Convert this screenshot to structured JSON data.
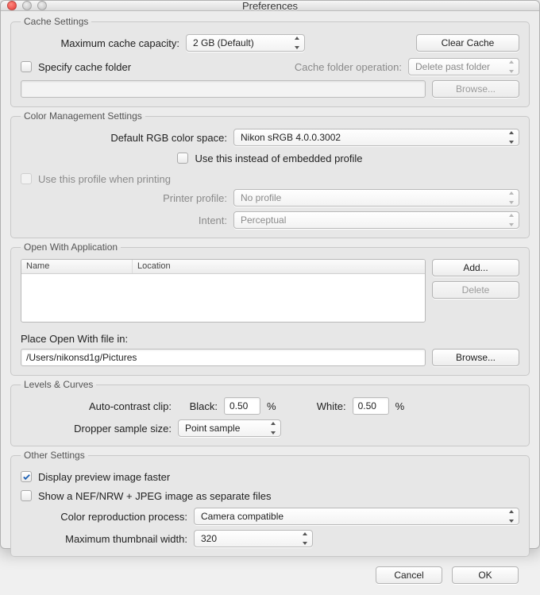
{
  "window": {
    "title": "Preferences"
  },
  "cache": {
    "legend": "Cache Settings",
    "max_label": "Maximum cache capacity:",
    "max_value": "2 GB (Default)",
    "clear_btn": "Clear Cache",
    "specify_label": "Specify cache folder",
    "operation_label": "Cache folder operation:",
    "operation_value": "Delete past folder",
    "folder_path": "",
    "browse_btn": "Browse..."
  },
  "color": {
    "legend": "Color Management Settings",
    "rgb_label": "Default RGB color space:",
    "rgb_value": "Nikon sRGB 4.0.0.3002",
    "use_instead_label": "Use this instead of embedded profile",
    "use_printing_label": "Use this profile when printing",
    "printer_label": "Printer profile:",
    "printer_value": "No profile",
    "intent_label": "Intent:",
    "intent_value": "Perceptual"
  },
  "openwith": {
    "legend": "Open With Application",
    "col_name": "Name",
    "col_location": "Location",
    "add_btn": "Add...",
    "delete_btn": "Delete",
    "place_label": "Place Open With file in:",
    "place_value": "/Users/nikonsd1g/Pictures",
    "browse_btn": "Browse..."
  },
  "levels": {
    "legend": "Levels & Curves",
    "clip_label": "Auto-contrast clip:",
    "black_label": "Black:",
    "black_value": "0.50",
    "white_label": "White:",
    "white_value": "0.50",
    "pct": "%",
    "dropper_label": "Dropper sample size:",
    "dropper_value": "Point sample"
  },
  "other": {
    "legend": "Other Settings",
    "display_faster_label": "Display preview image faster",
    "nef_label": "Show a NEF/NRW + JPEG image as separate files",
    "repro_label": "Color reproduction process:",
    "repro_value": "Camera compatible",
    "thumb_label": "Maximum thumbnail width:",
    "thumb_value": "320"
  },
  "buttons": {
    "cancel": "Cancel",
    "ok": "OK"
  }
}
